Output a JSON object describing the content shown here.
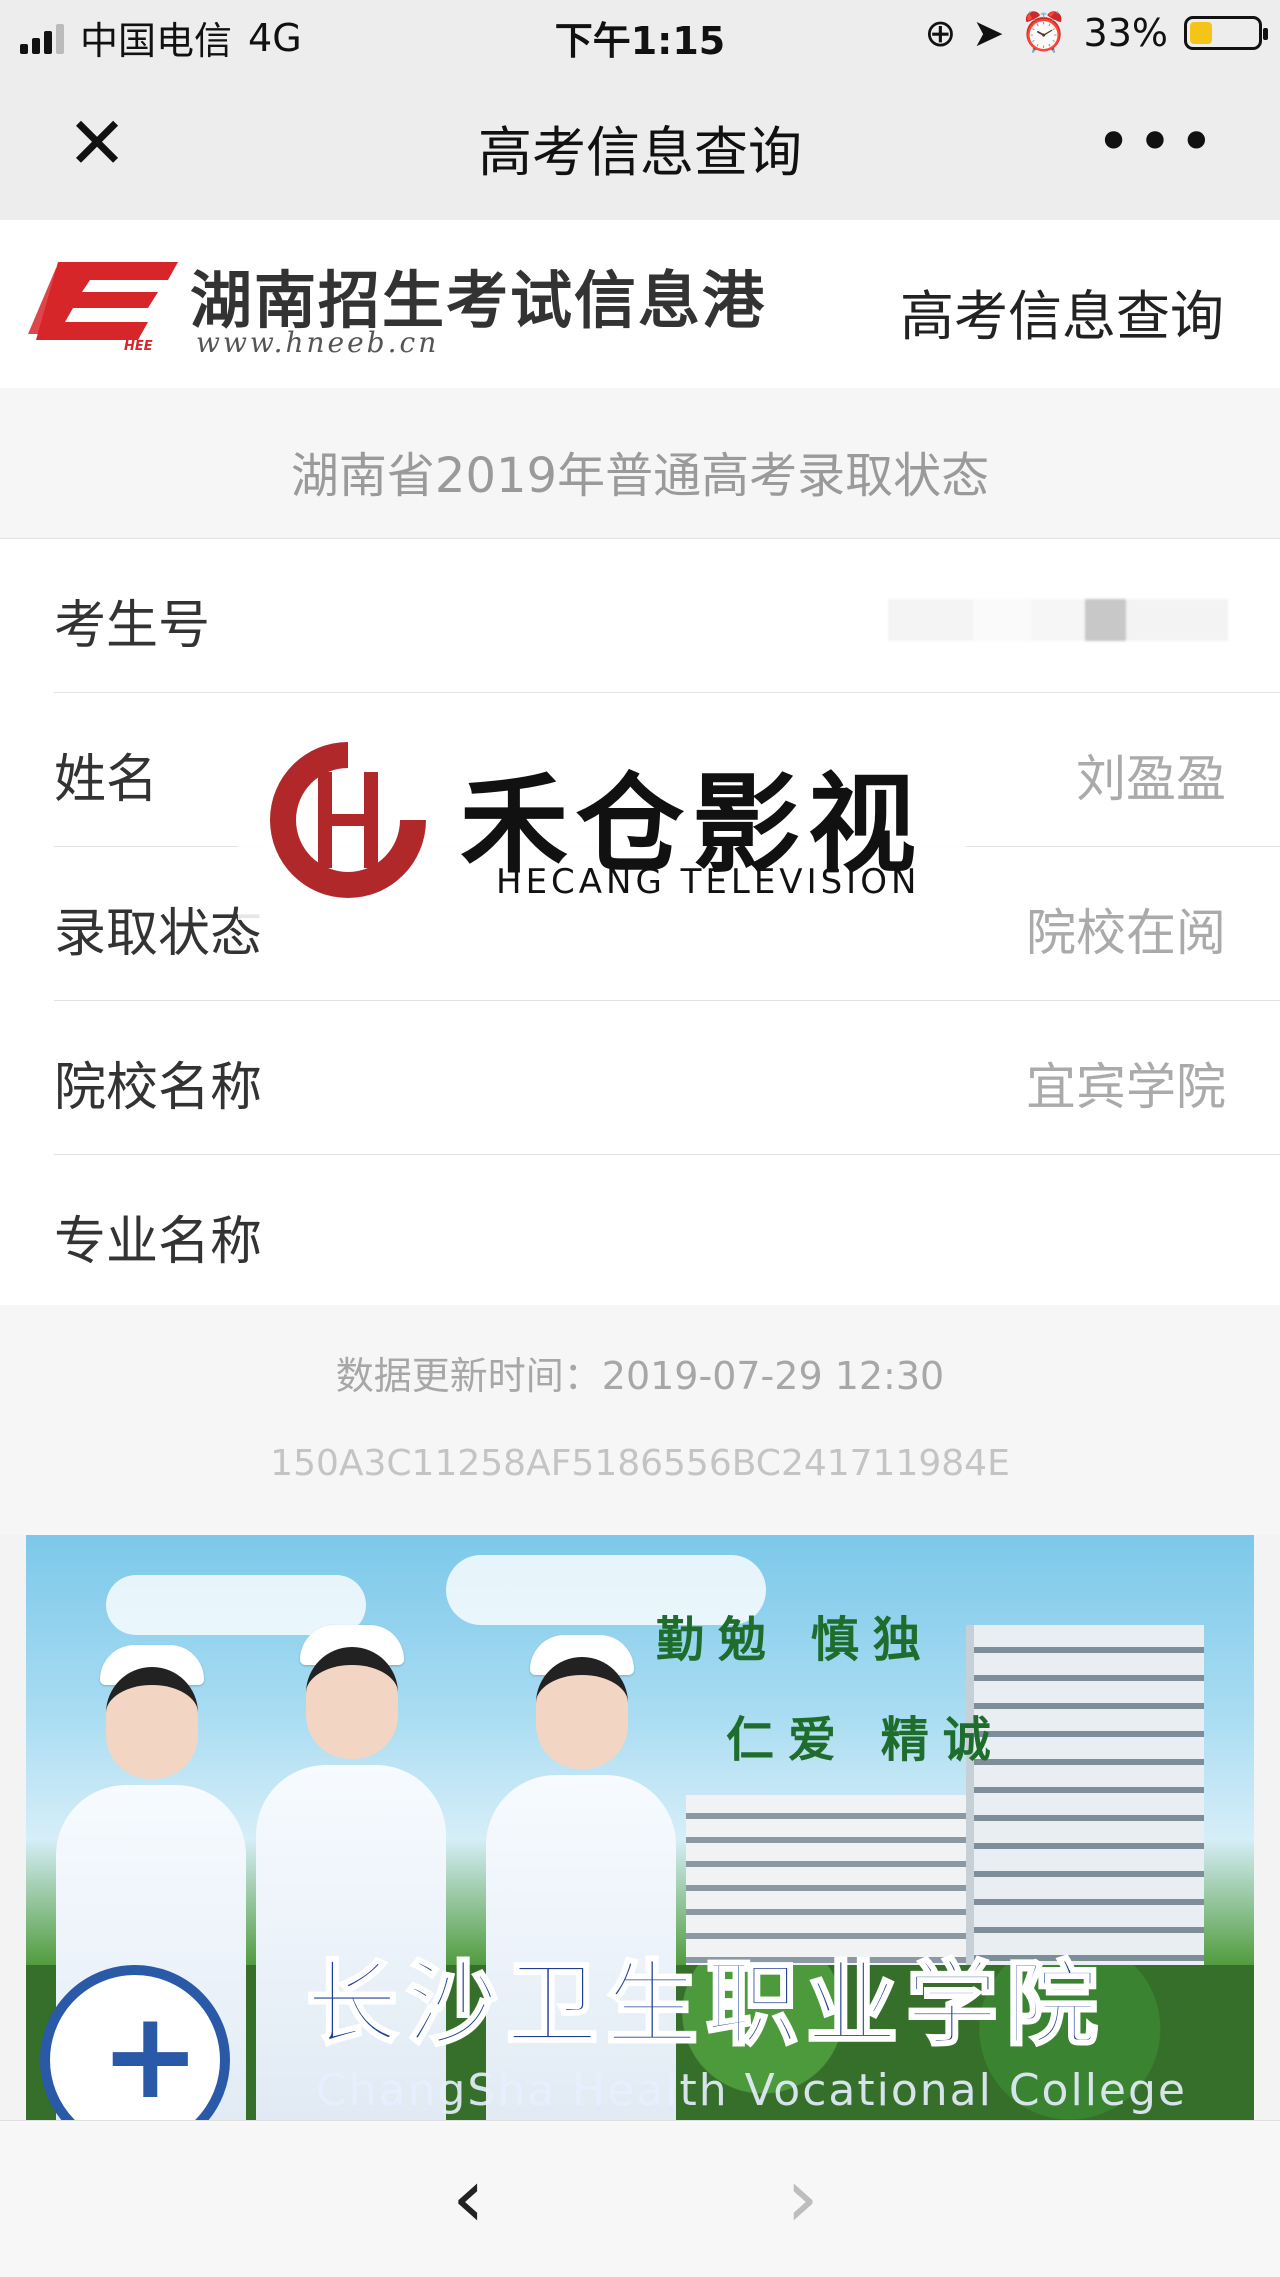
{
  "status_bar": {
    "carrier": "中国电信",
    "network": "4G",
    "time": "下午1:15",
    "battery": "33%",
    "battery_level": 0.33
  },
  "nav": {
    "title": "高考信息查询",
    "close_icon": "close-icon",
    "more_icon": "more-icon"
  },
  "site": {
    "logo_name": "湖南招生考试信息港",
    "logo_url": "www.hneeb.cn",
    "logo_badge": "HEE",
    "header_link": "高考信息查询"
  },
  "result": {
    "title": "湖南省2019年普通高考录取状态",
    "rows": [
      {
        "label": "考生号",
        "value": ""
      },
      {
        "label": "姓名",
        "value": "刘盈盈"
      },
      {
        "label": "录取状态",
        "value": "院校在阅"
      },
      {
        "label": "院校名称",
        "value": "宜宾学院"
      },
      {
        "label": "专业名称",
        "value": ""
      }
    ],
    "update_time": "数据更新时间：2019-07-29 12:30",
    "hash": "150A3C11258AF5186556BC241711984E"
  },
  "banner": {
    "slogan_line1": "勤勉 慎独",
    "slogan_line2": "仁爱 精诚",
    "college_name": "长沙卫生职业学院",
    "college_en": "ChangSha Health Vocational College"
  },
  "watermark": {
    "name_cn": "禾仓影视",
    "name_en": "HECANG TELEVISION"
  },
  "bottom_nav": {
    "back": "‹",
    "forward": "›"
  },
  "colors": {
    "logo_red": "#d7262a",
    "watermark_red": "#b0282a",
    "college_blue": "#1f3f95"
  }
}
